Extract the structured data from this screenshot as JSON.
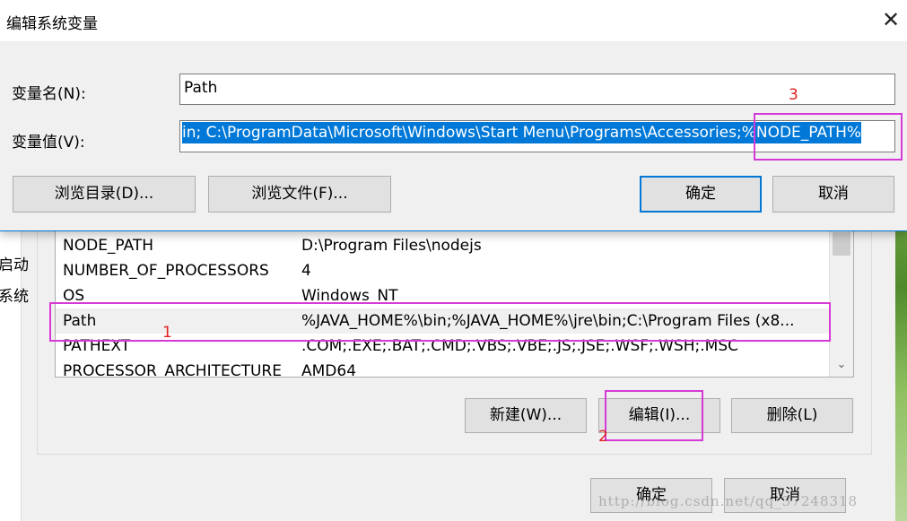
{
  "edit_dialog": {
    "title": "编辑系统变量",
    "close_icon": "✕",
    "name_label": "变量名(N):",
    "name_value": "Path",
    "value_label": "变量值(V):",
    "value_selected_text": "in;  C:\\ProgramData\\Microsoft\\Windows\\Start Menu\\Programs\\Accessories;%NODE_PATH%",
    "browse_dir_button": "浏览目录(D)...",
    "browse_file_button": "浏览文件(F)...",
    "ok_button": "确定",
    "cancel_button": "取消"
  },
  "parent_dialog": {
    "left_clipped_texts": [
      "启动",
      "系统"
    ],
    "system_variables": [
      {
        "name": "NODE_PATH",
        "value": "D:\\Program Files\\nodejs"
      },
      {
        "name": "NUMBER_OF_PROCESSORS",
        "value": "4"
      },
      {
        "name": "OS",
        "value": "Windows_NT"
      },
      {
        "name": "Path",
        "value": "%JAVA_HOME%\\bin;%JAVA_HOME%\\jre\\bin;C:\\Program Files (x8..."
      },
      {
        "name": "PATHEXT",
        "value": ".COM;.EXE;.BAT;.CMD;.VBS;.VBE;.JS;.JSE;.WSF;.WSH;.MSC"
      },
      {
        "name": "PROCESSOR_ARCHITECTURE",
        "value": "AMD64"
      }
    ],
    "new_button": "新建(W)...",
    "edit_button": "编辑(I)...",
    "delete_button": "删除(L)",
    "ok_button": "确定",
    "cancel_button": "取消",
    "scroll_down_icon": "chevron-down-icon"
  },
  "annotations": {
    "mark_1": "1",
    "mark_2": "2",
    "mark_3": "3"
  },
  "watermark": "http://blog.csdn.net/qq_37248318",
  "colors": {
    "selection": "#0078d7",
    "annotation_box": "#d63ad6",
    "annotation_number": "#e02020"
  }
}
